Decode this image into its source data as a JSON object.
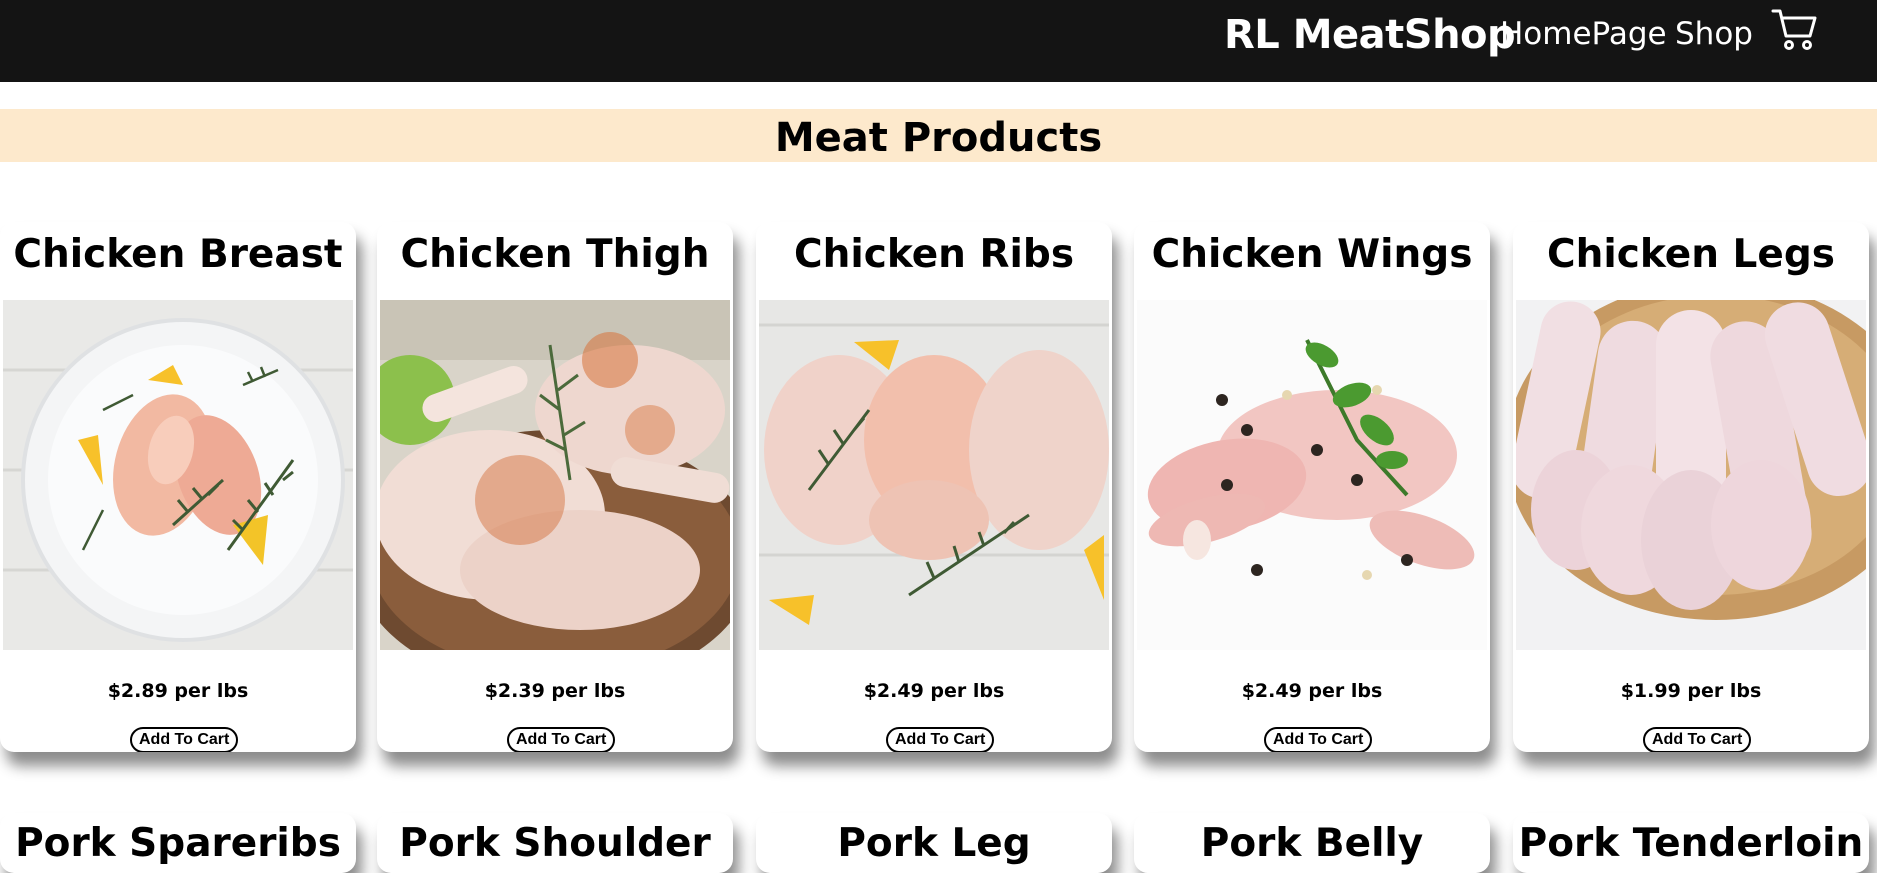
{
  "navbar": {
    "brand": "RL MeatShop",
    "links": [
      "HomePage",
      "Shop"
    ],
    "cart_icon": "shopping-cart-icon"
  },
  "banner": {
    "title": "Meat Products"
  },
  "products": [
    {
      "name": "Chicken Breast",
      "price": "$2.89 per lbs",
      "button": "Add To Cart"
    },
    {
      "name": "Chicken Thigh",
      "price": "$2.39 per lbs",
      "button": "Add To Cart"
    },
    {
      "name": "Chicken Ribs",
      "price": "$2.49 per lbs",
      "button": "Add To Cart"
    },
    {
      "name": "Chicken Wings",
      "price": "$2.49 per lbs",
      "button": "Add To Cart"
    },
    {
      "name": "Chicken Legs",
      "price": "$1.99 per lbs",
      "button": "Add To Cart"
    }
  ],
  "products_row2": [
    {
      "name": "Pork Spareribs"
    },
    {
      "name": "Pork Shoulder"
    },
    {
      "name": "Pork Leg"
    },
    {
      "name": "Pork Belly"
    },
    {
      "name": "Pork Tenderloin"
    }
  ],
  "colors": {
    "navbar": "#141414",
    "banner": "#fde9cc"
  }
}
